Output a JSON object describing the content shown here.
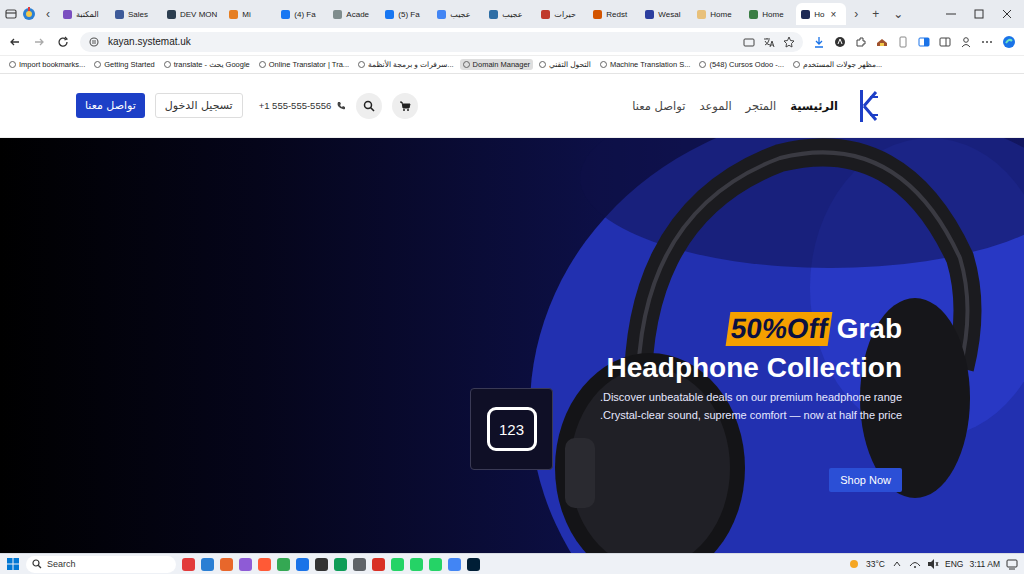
{
  "tabs": [
    {
      "label": "المكتبة",
      "color": "#7a4fc0",
      "selected": false
    },
    {
      "label": "Sales",
      "color": "#3d5a99",
      "selected": false
    },
    {
      "label": "DEV MON",
      "color": "#2c3e50",
      "selected": false
    },
    {
      "label": "Mi",
      "color": "#e67e22",
      "selected": false
    },
    {
      "label": "(4) Fa",
      "color": "#1877f2",
      "selected": false
    },
    {
      "label": "Acade",
      "color": "#7f8c8d",
      "selected": false
    },
    {
      "label": "(5) Fa",
      "color": "#1877f2",
      "selected": false
    },
    {
      "label": "عجيب",
      "color": "#4285f4",
      "selected": false
    },
    {
      "label": "عجيب",
      "color": "#2f6ea5",
      "selected": false
    },
    {
      "label": "حيرات",
      "color": "#c0392b",
      "selected": false
    },
    {
      "label": "Redst",
      "color": "#d35400",
      "selected": false
    },
    {
      "label": "Wesal",
      "color": "#2c3e9f",
      "selected": false
    },
    {
      "label": "Home",
      "color": "#e8c07a",
      "selected": false
    },
    {
      "label": "Home",
      "color": "#3a7d44",
      "selected": false
    },
    {
      "label": "Ho",
      "color": "#1e2a55",
      "selected": true
    }
  ],
  "tab_close": "×",
  "tab_nav": {
    "left": "‹",
    "right": "›",
    "new": "+",
    "list": "⌄"
  },
  "address": {
    "url": "kayan.systemat.uk"
  },
  "bookmarks": [
    {
      "label": "Import bookmarks...",
      "selected": false
    },
    {
      "label": "Getting Started",
      "selected": false
    },
    {
      "label": "translate - يحث Google",
      "selected": false
    },
    {
      "label": "Online Translator | Tra...",
      "selected": false
    },
    {
      "label": "سرفرات و برمجة الأنظمة...",
      "selected": false
    },
    {
      "label": "Domain Manager",
      "selected": true
    },
    {
      "label": "التحول التقني",
      "selected": false
    },
    {
      "label": "Machine Translation S...",
      "selected": false
    },
    {
      "label": "(548) Cursos Odoo -...",
      "selected": false
    },
    {
      "label": "مظهر جولات المستخدم...",
      "selected": false
    }
  ],
  "site": {
    "contact_button": "تواصل معنا",
    "login_button": "تسجيل الدخول",
    "phone": "+1 555-555-5556",
    "nav": [
      {
        "label": "الرئيسية",
        "selected": true
      },
      {
        "label": "المتجر",
        "selected": false
      },
      {
        "label": "الموعد",
        "selected": false
      },
      {
        "label": "تواصل معنا",
        "selected": false
      }
    ]
  },
  "hero": {
    "badge": "50%Off",
    "title_start": "Grab",
    "title": "Headphone Collection",
    "lines": [
      ".Discover unbeatable deals on our premium headphone range",
      ".Crystal-clear sound, supreme comfort — now at half the price"
    ],
    "button": "Shop Now",
    "counter": "123"
  },
  "taskbar": {
    "search": "Search",
    "apps": [
      {
        "color": "#e23b3b"
      },
      {
        "color": "#2a7fd4"
      },
      {
        "color": "#e8672b"
      },
      {
        "color": "#8e5bd6"
      },
      {
        "color": "#ff5a36"
      },
      {
        "color": "#34a853"
      },
      {
        "color": "#1a73e8"
      },
      {
        "color": "#333333"
      },
      {
        "color": "#0f9d58"
      },
      {
        "color": "#5f6368"
      },
      {
        "color": "#d93025"
      },
      {
        "color": "#25d366"
      },
      {
        "color": "#25d366"
      },
      {
        "color": "#25d366"
      },
      {
        "color": "#4285f4"
      },
      {
        "color": "#001e36"
      }
    ],
    "weather": "33°C",
    "lang": "ENG",
    "time": "3:11 AM"
  }
}
